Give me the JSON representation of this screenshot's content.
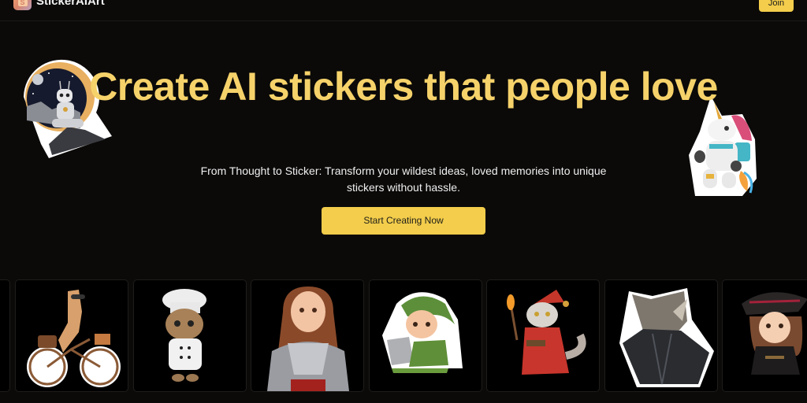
{
  "header": {
    "brand": "StickerAIArt",
    "logo_icon": "sticker-logo-icon",
    "logo_letter": "S",
    "join_label": "Join"
  },
  "hero": {
    "title": "Create AI stickers that people love",
    "subtitle": "From Thought to Sticker: Transform your wildest ideas, loved memories into unique stickers without hassle.",
    "cta_label": "Start Creating Now",
    "accent_color": "#f3cd4b",
    "title_color": "#f6d26a"
  },
  "floating_stickers": [
    {
      "subject": "robot sitting on moon rock",
      "icon": "robot-sticker"
    },
    {
      "subject": "unicorn astronaut",
      "icon": "unicorn-sticker"
    }
  ],
  "gallery": {
    "items": [
      {
        "subject": "partial sticker (cut off)"
      },
      {
        "subject": "llama riding bicycle"
      },
      {
        "subject": "kitten chef"
      },
      {
        "subject": "woman in knight armor"
      },
      {
        "subject": "elf with laptop"
      },
      {
        "subject": "cat wizard with torch"
      },
      {
        "subject": "rhino in leather jacket"
      },
      {
        "subject": "witch girl"
      }
    ]
  }
}
